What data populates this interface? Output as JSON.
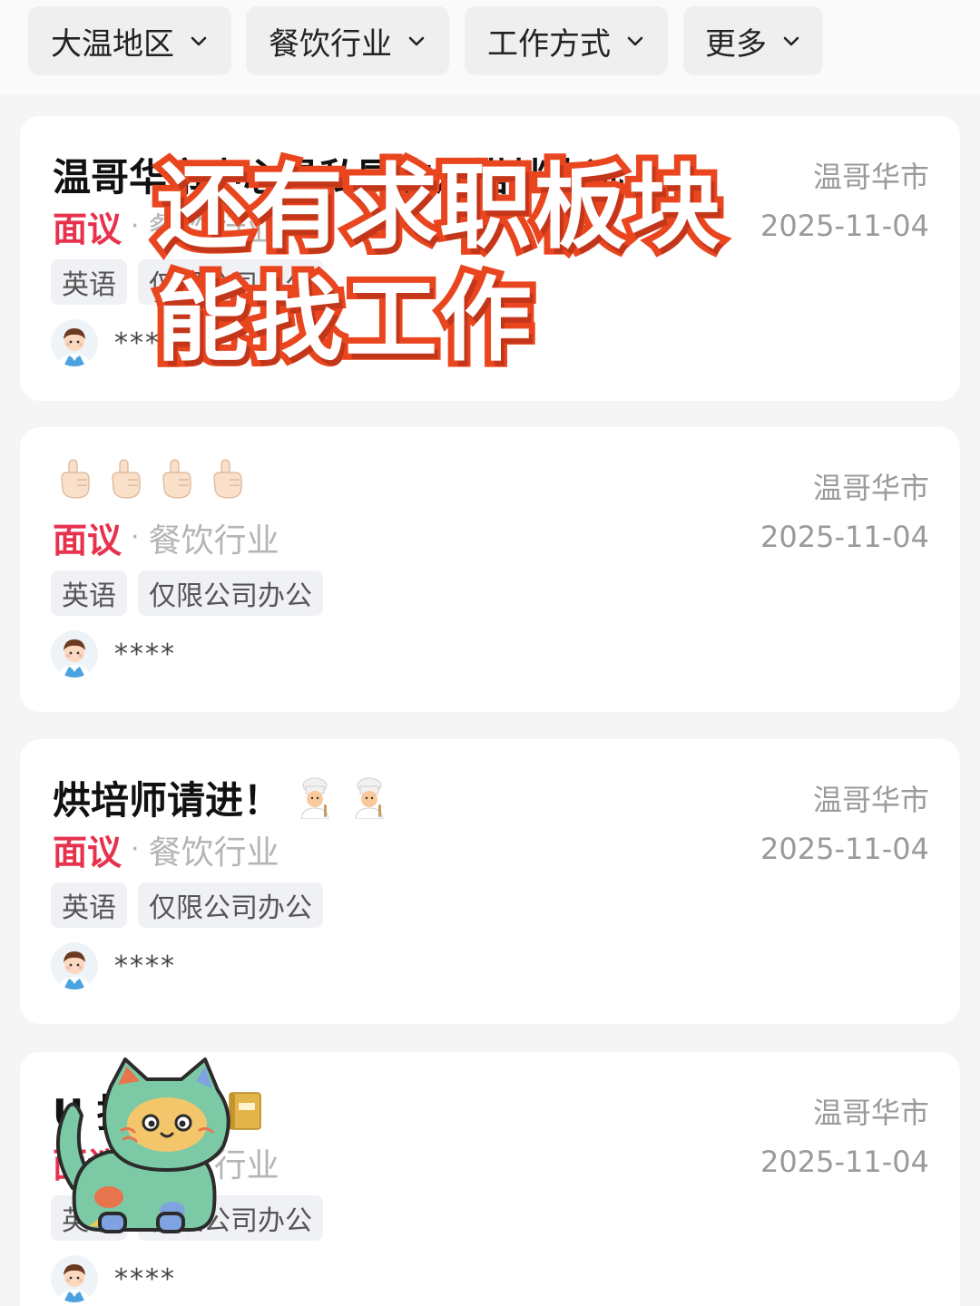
{
  "filters": [
    {
      "label": "大温地区"
    },
    {
      "label": "餐饮行业"
    },
    {
      "label": "工作方式"
    },
    {
      "label": "更多"
    }
  ],
  "caption": {
    "line1": "还有求职板块",
    "line2": "能找工作"
  },
  "jobs": [
    {
      "title": "温哥华市中心寻私厨生活搭档人选",
      "salary": "面议",
      "industry": "餐饮行业",
      "tags": [
        "英语",
        "仅限公司办公"
      ],
      "poster": "****",
      "city": "温哥华市",
      "date": "2025-11-04"
    },
    {
      "title": "",
      "title_emoji": [
        "pointing-hand",
        "pointing-hand",
        "pointing-hand",
        "pointing-hand"
      ],
      "salary": "面议",
      "industry": "餐饮行业",
      "tags": [
        "英语",
        "仅限公司办公"
      ],
      "poster": "****",
      "city": "温哥华市",
      "date": "2025-11-04"
    },
    {
      "title": "烘培师请进！",
      "title_emoji": [
        "chef",
        "chef"
      ],
      "salary": "面议",
      "industry": "餐饮行业",
      "tags": [
        "英语",
        "仅限公司办公"
      ],
      "poster": "****",
      "city": "温哥华市",
      "date": "2025-11-04"
    },
    {
      "title": "U 招人啦",
      "title_emoji": [
        "notebook"
      ],
      "salary": "面议",
      "industry": "餐饮行业",
      "tags": [
        "英语",
        "仅限公司办公"
      ],
      "poster": "****",
      "city": "温哥华市",
      "date": "2025-11-04"
    }
  ],
  "colors": {
    "salary": "#e8324d",
    "caption_stroke": "#e9461f",
    "page_bg": "#f5f5f5"
  }
}
